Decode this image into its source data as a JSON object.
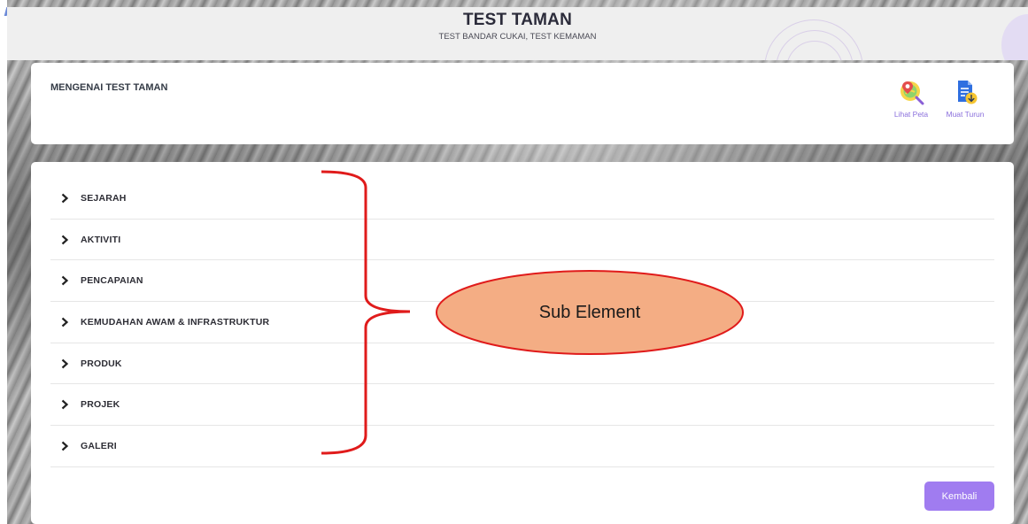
{
  "header": {
    "title": "TEST TAMAN",
    "subtitle": "TEST BANDAR CUKAI, TEST KEMAMAN"
  },
  "about": {
    "title": "MENGENAI TEST TAMAN",
    "actions": [
      {
        "label": "Lihat Peta",
        "icon": "map-search-icon"
      },
      {
        "label": "Muat Turun",
        "icon": "download-document-icon"
      }
    ]
  },
  "sections": [
    {
      "label": "SEJARAH"
    },
    {
      "label": "AKTIVITI"
    },
    {
      "label": "PENCAPAIAN"
    },
    {
      "label": "KEMUDAHAN AWAM & INFRASTRUKTUR"
    },
    {
      "label": "PRODUK"
    },
    {
      "label": "PROJEK"
    },
    {
      "label": "GALERI"
    }
  ],
  "back_button": {
    "label": "Kembali"
  },
  "annotation": {
    "label": "Sub Element",
    "callout_color": "#f4ad84",
    "brace_color": "#e01b1b"
  },
  "colors": {
    "accent": "#a07cf0",
    "link": "#8a6fdc",
    "header_bg": "#efefef"
  }
}
